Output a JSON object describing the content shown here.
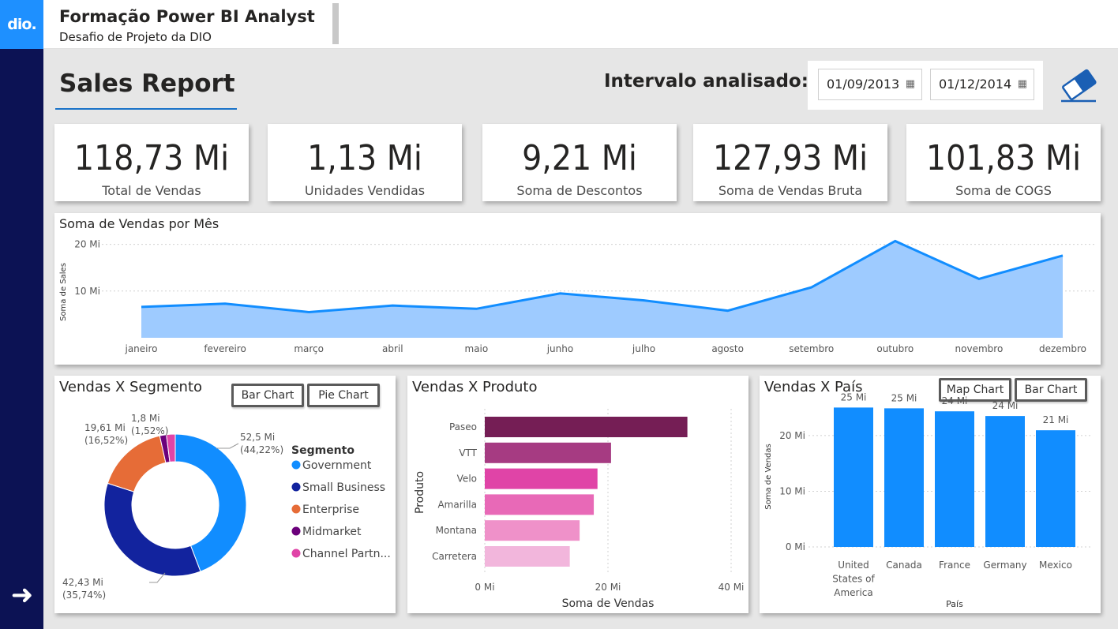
{
  "header": {
    "logo": "dio.",
    "title": "Formação Power BI Analyst",
    "subtitle": "Desafio de Projeto da DIO"
  },
  "report": {
    "title": "Sales Report",
    "interval_label": "Intervalo analisado:",
    "date_start": "01/09/2013",
    "date_end": "01/12/2014"
  },
  "kpis": [
    {
      "value": "118,73 Mi",
      "label": "Total de Vendas"
    },
    {
      "value": "1,13 Mi",
      "label": "Unidades Vendidas"
    },
    {
      "value": "9,21 Mi",
      "label": "Soma de Descontos"
    },
    {
      "value": "127,93 Mi",
      "label": "Soma de Vendas Bruta"
    },
    {
      "value": "101,83 Mi",
      "label": "Soma de COGS"
    }
  ],
  "colors": {
    "accent": "#118dff",
    "area_fill": "#9ecbff",
    "nav": "#0c1254",
    "logo_bg": "#1e90ff"
  },
  "chart_data": [
    {
      "type": "area",
      "title": "Soma de Vendas por Mês",
      "ylabel": "Soma de Sales",
      "xlabel": "",
      "categories": [
        "janeiro",
        "fevereiro",
        "março",
        "abril",
        "maio",
        "junho",
        "julho",
        "agosto",
        "setembro",
        "outubro",
        "novembro",
        "dezembro"
      ],
      "values": [
        6.6,
        7.3,
        5.5,
        6.9,
        6.2,
        9.5,
        8.0,
        5.8,
        10.8,
        20.7,
        12.6,
        17.6
      ],
      "yticks": [
        "10 Mi",
        "20 Mi"
      ],
      "ytick_values": [
        10,
        20
      ],
      "ylim": [
        0,
        25
      ],
      "grid": true
    },
    {
      "type": "pie",
      "title": "Vendas X Segmento",
      "legend_title": "Segmento",
      "legend_position": "right",
      "slices": [
        {
          "name": "Government",
          "value": 52.5,
          "label": "52,5 Mi",
          "pct": "(44,22%)",
          "color": "#118dff"
        },
        {
          "name": "Small Business",
          "value": 42.43,
          "label": "42,43 Mi",
          "pct": "(35,74%)",
          "color": "#12239e"
        },
        {
          "name": "Enterprise",
          "value": 19.61,
          "label": "19,61 Mi",
          "pct": "(16,52%)",
          "color": "#e66c37"
        },
        {
          "name": "Midmarket",
          "value": 1.8,
          "label": "1,8 Mi",
          "pct": "(1,52%)",
          "color": "#6b007b"
        },
        {
          "name": "Channel Partn...",
          "value": 2.38,
          "label": "",
          "pct": "",
          "color": "#e044a7"
        }
      ],
      "buttons": [
        "Bar Chart",
        "Pie Chart"
      ]
    },
    {
      "type": "bar",
      "orientation": "horizontal",
      "title": "Vendas X Produto",
      "categories": [
        "Paseo",
        "VTT",
        "Velo",
        "Amarilla",
        "Montana",
        "Carretera"
      ],
      "values": [
        32.9,
        20.5,
        18.3,
        17.7,
        15.4,
        13.8
      ],
      "colors": [
        "#751e55",
        "#a63b82",
        "#e044a7",
        "#e869b7",
        "#ef91c9",
        "#f2b6dc"
      ],
      "xlabel": "Soma de Vendas",
      "ylabel": "Produto",
      "xticks": [
        "0 Mi",
        "20 Mi",
        "40 Mi"
      ],
      "xtick_values": [
        0,
        20,
        40
      ],
      "xlim": [
        0,
        40
      ]
    },
    {
      "type": "bar",
      "orientation": "vertical",
      "title": "Vendas X País",
      "categories": [
        "United States of America",
        "Canada",
        "France",
        "Germany",
        "Mexico"
      ],
      "category_lines": [
        [
          "United",
          "States of",
          "America"
        ],
        [
          "Canada"
        ],
        [
          "France"
        ],
        [
          "Germany"
        ],
        [
          "Mexico"
        ]
      ],
      "values": [
        25.03,
        24.89,
        24.35,
        23.51,
        20.95
      ],
      "data_labels": [
        "25 Mi",
        "25 Mi",
        "24 Mi",
        "24 Mi",
        "21 Mi"
      ],
      "xlabel": "País",
      "ylabel": "Soma de Vendas",
      "yticks": [
        "0 Mi",
        "10 Mi",
        "20 Mi"
      ],
      "ytick_values": [
        0,
        10,
        20
      ],
      "ylim": [
        0,
        25
      ],
      "buttons": [
        "Map Chart",
        "Bar Chart"
      ]
    }
  ]
}
